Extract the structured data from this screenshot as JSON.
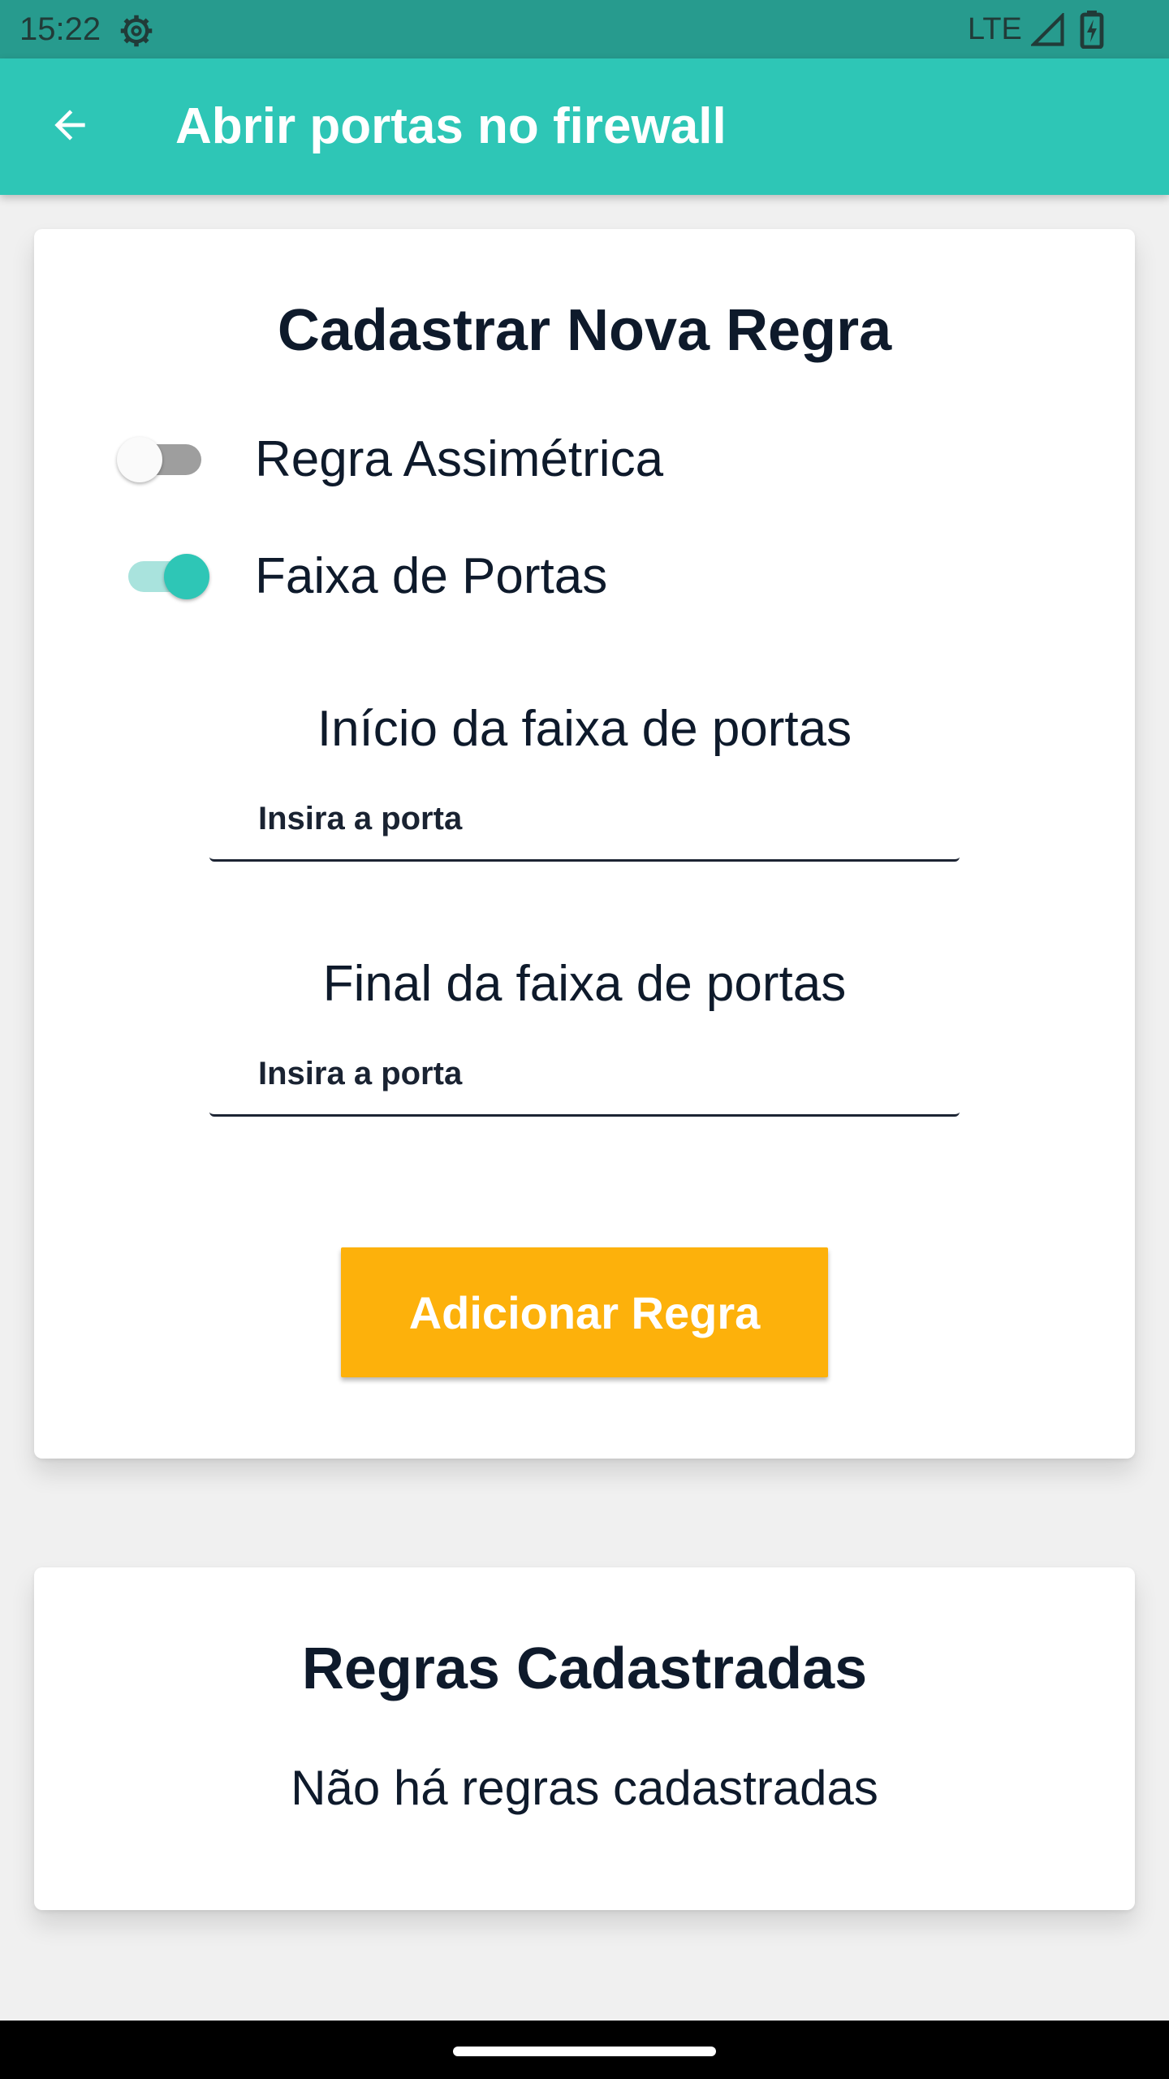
{
  "status_bar": {
    "time": "15:22",
    "network": "LTE",
    "icons": [
      "settings-gear-icon",
      "cell-signal-icon",
      "battery-charging-icon"
    ]
  },
  "app_bar": {
    "title": "Abrir portas no firewall",
    "back_icon": "arrow-left-icon",
    "color": "#2ec6b6"
  },
  "new_rule_card": {
    "title": "Cadastrar Nova Regra",
    "switches": [
      {
        "label": "Regra Assimétrica",
        "checked": false
      },
      {
        "label": "Faixa de Portas",
        "checked": true
      }
    ],
    "start_range": {
      "heading": "Início da faixa de portas",
      "placeholder": "Insira a porta",
      "value": ""
    },
    "end_range": {
      "heading": "Final da faixa de portas",
      "placeholder": "Insira a porta",
      "value": ""
    },
    "add_button_label": "Adicionar Regra",
    "add_button_color": "#fdb10b"
  },
  "rules_card": {
    "title": "Regras Cadastradas",
    "empty_message": "Não há regras cadastradas"
  }
}
